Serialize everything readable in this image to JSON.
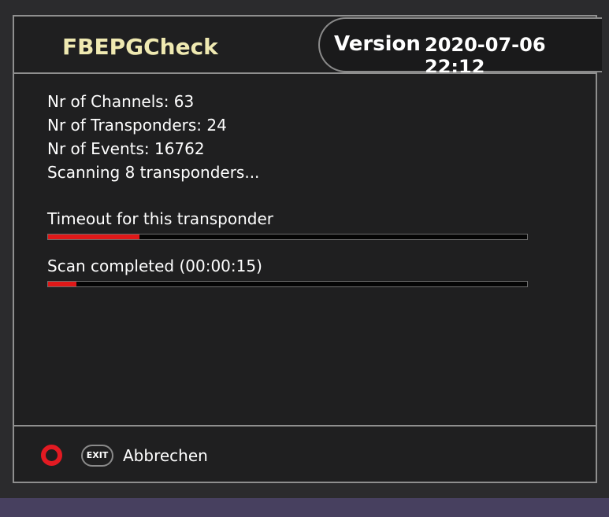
{
  "header": {
    "title": "FBEPGCheck",
    "version_label": "Version",
    "version_value": "2020-07-06 22:12"
  },
  "info": {
    "channels": "Nr of Channels: 63",
    "transponders": "Nr of Transponders: 24",
    "events": "Nr of Events: 16762",
    "scanning": "Scanning 8 transponders..."
  },
  "progress": [
    {
      "label": "Timeout for this transponder",
      "fraction": 0.19
    },
    {
      "label": "Scan completed (00:00:15)",
      "fraction": 0.06
    }
  ],
  "footer": {
    "red_icon": "red-button-icon",
    "exit_key": "EXIT",
    "cancel_label": "Abbrechen"
  },
  "colors": {
    "title": "#efe9b1",
    "progress": "#e01818",
    "background": "#1f1f20",
    "accent_bar": "#47405f"
  }
}
